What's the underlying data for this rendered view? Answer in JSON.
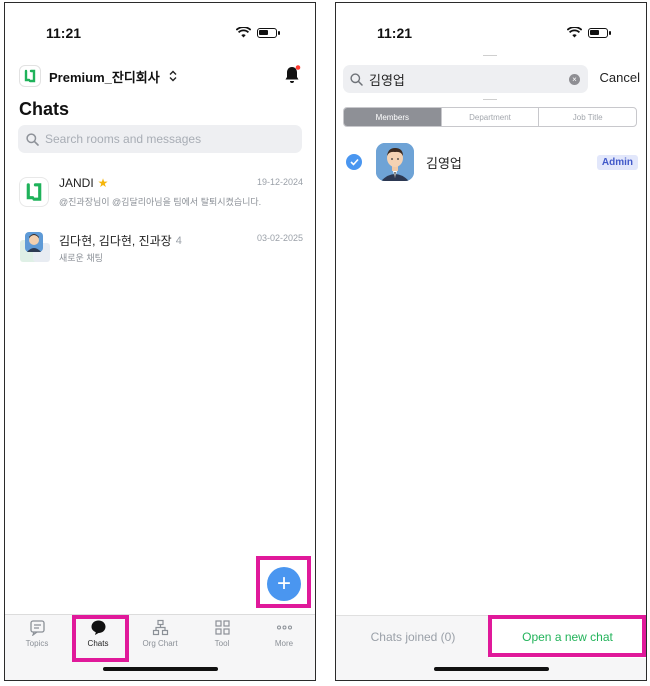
{
  "status": {
    "time": "11:21"
  },
  "left": {
    "workspace": {
      "name": "Premium_잔디회사",
      "switch_icon": "chevron-updown-icon"
    },
    "title": "Chats",
    "search": {
      "placeholder": "Search rooms and messages"
    },
    "chats": [
      {
        "name": "JANDI",
        "star": "★",
        "count": "",
        "preview": "@진과장님이 @김달리아님을 팀에서 탈퇴시켰습니다.",
        "date": "19-12-2024"
      },
      {
        "name": "김다현, 김다현, 진과장",
        "star": "",
        "count": "4",
        "preview": "새로운 채팅",
        "date": "03-02-2025"
      }
    ],
    "fab_label": "+",
    "tabs": [
      {
        "label": "Topics",
        "icon": "topics-icon"
      },
      {
        "label": "Chats",
        "icon": "chat-bubble-icon"
      },
      {
        "label": "Org Chart",
        "icon": "org-chart-icon"
      },
      {
        "label": "Tool",
        "icon": "grid-icon"
      },
      {
        "label": "More",
        "icon": "more-dots-icon"
      }
    ],
    "active_tab": "Chats"
  },
  "right": {
    "search": {
      "value": "김영업"
    },
    "cancel_label": "Cancel",
    "segments": [
      "Members",
      "Department",
      "Job Title"
    ],
    "active_segment": "Members",
    "member": {
      "name": "김영업",
      "badge": "Admin",
      "selected": true
    },
    "bottom": {
      "joined_label": "Chats joined (0)",
      "open_label": "Open a new chat"
    }
  },
  "colors": {
    "accent": "#4a96f0",
    "highlight": "#e0199a",
    "jandi_green": "#1fb25a",
    "open_chat": "#22b35a"
  }
}
